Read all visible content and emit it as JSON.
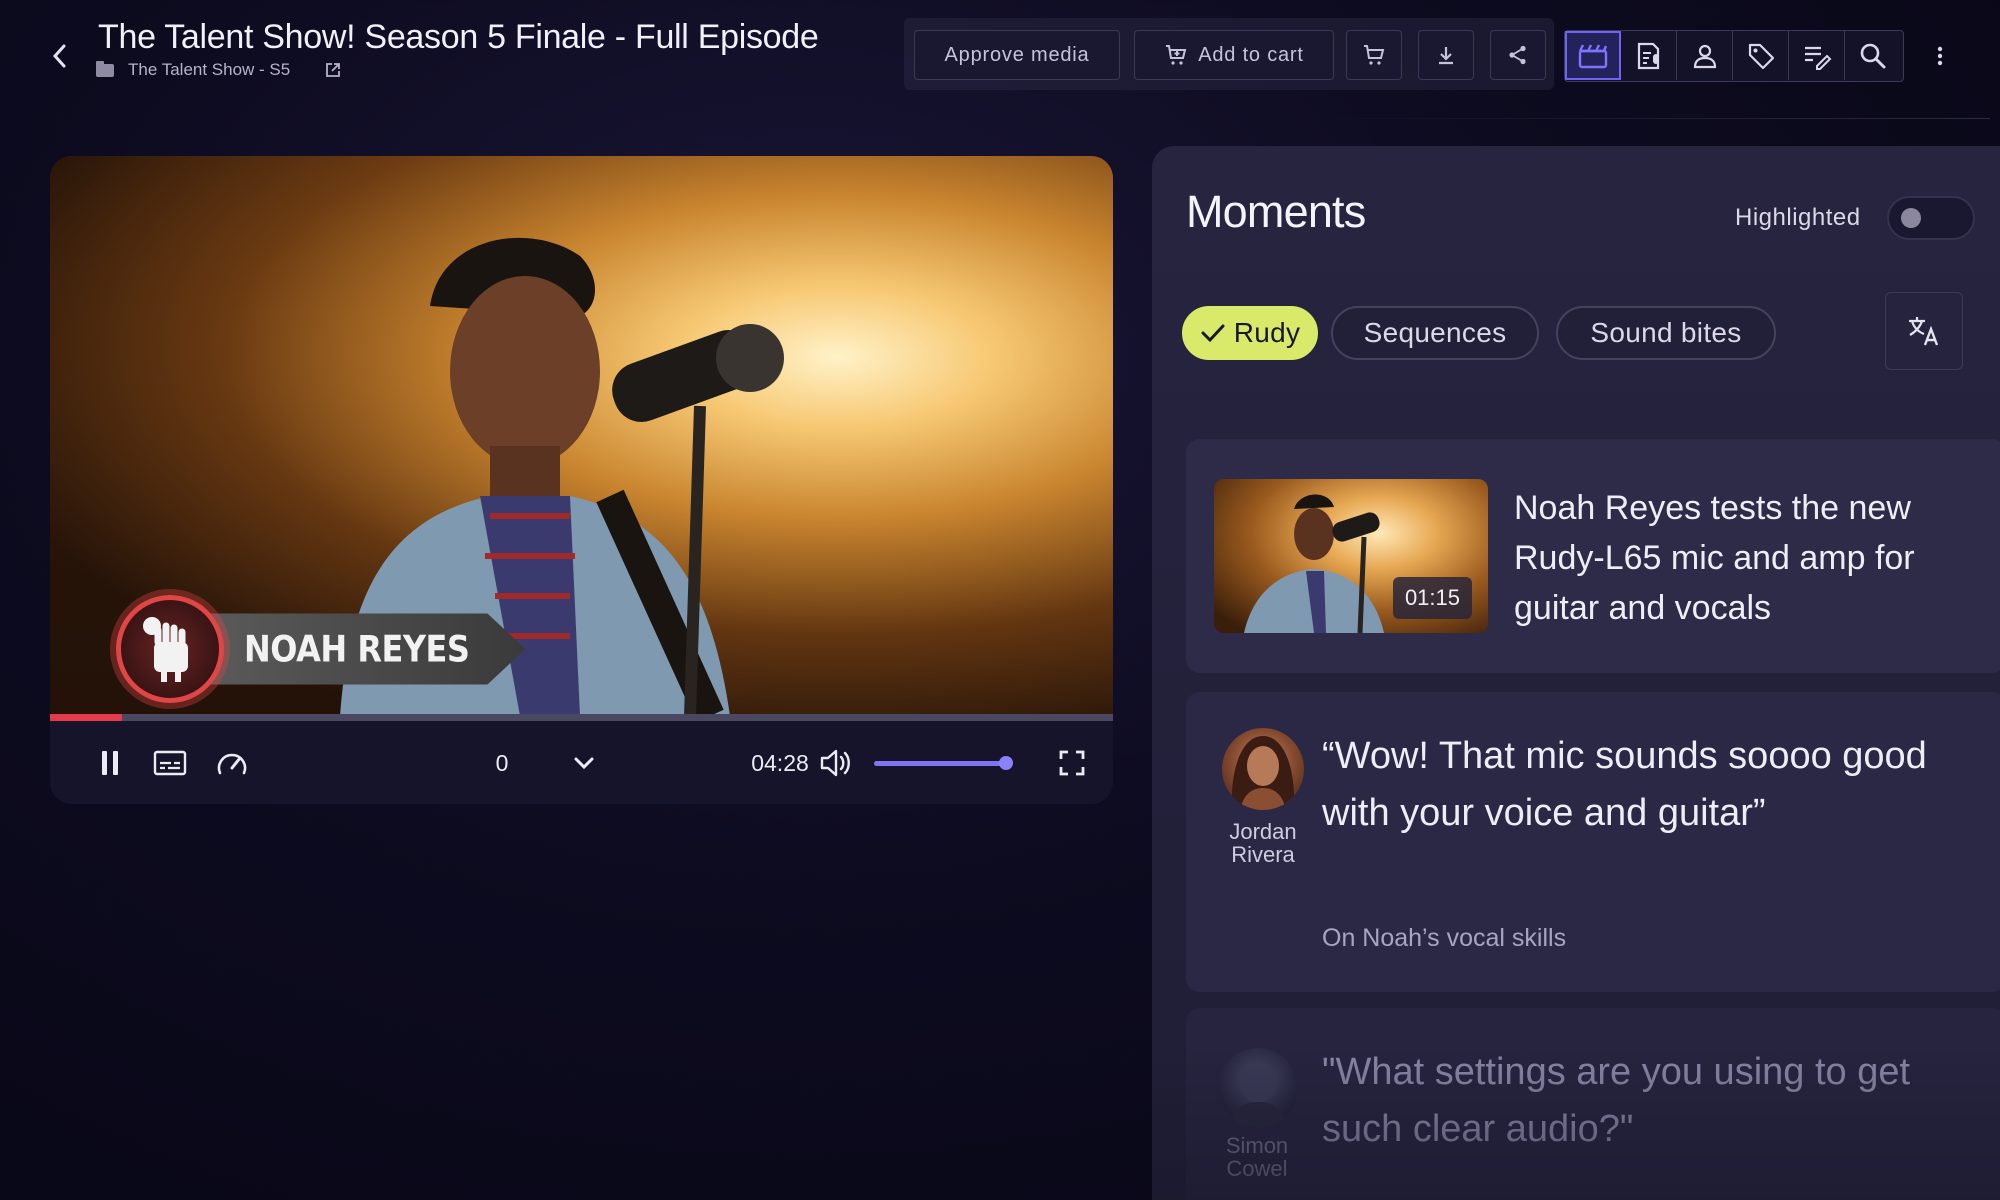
{
  "header": {
    "title": "The Talent Show! Season 5 Finale - Full Episode",
    "breadcrumb": "The Talent Show - S5",
    "back_icon": "chevron-left-icon"
  },
  "toolbar": {
    "approve_label": "Approve media",
    "add_to_cart_label": "Add to cart",
    "icons": [
      "cart-icon",
      "download-icon",
      "share-icon",
      "scenes-icon",
      "transcript-icon",
      "people-icon",
      "tag-icon",
      "notes-icon",
      "search-icon",
      "more-icon"
    ],
    "active_tool": "scenes-icon"
  },
  "player": {
    "lower_third_name": "NOAH REYES",
    "speed_value": "0",
    "duration": "04:28",
    "progress_fraction": 0.068,
    "volume_fraction": 0.96,
    "state": "playing"
  },
  "moments": {
    "title": "Moments",
    "highlighted_label": "Highlighted",
    "highlighted_on": false,
    "chips": [
      {
        "label": "Rudy",
        "active": true
      },
      {
        "label": "Sequences",
        "active": false
      },
      {
        "label": "Sound bites",
        "active": false
      }
    ],
    "cards": [
      {
        "type": "clip",
        "time": "01:15",
        "description": "Noah Reyes tests the new Rudy-L65 mic and amp for guitar and vocals"
      },
      {
        "type": "quote",
        "speaker": "Jordan Rivera",
        "quote": "“Wow! That mic sounds soooo good with your voice and guitar”",
        "context": "On Noah’s vocal skills"
      },
      {
        "type": "quote",
        "speaker": "Simon Cowel",
        "quote": "\"What settings are you using to get such clear audio?\""
      }
    ]
  },
  "colors": {
    "accent": "#6e63f2",
    "chip_active": "#d9ea6a",
    "progress": "#e33b4a",
    "lower_third_red": "#e04646"
  }
}
